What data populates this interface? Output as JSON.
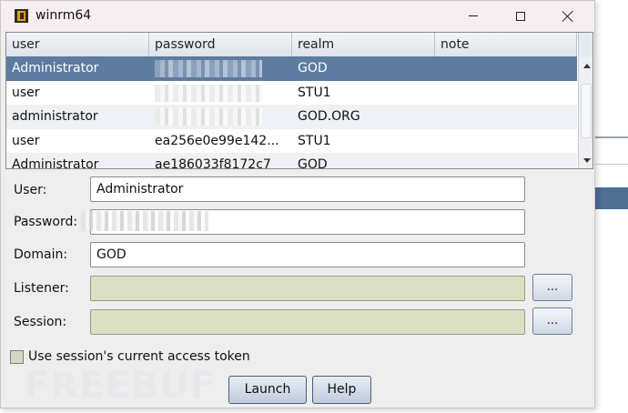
{
  "window": {
    "title": "winrm64",
    "controls": [
      "minimize-icon",
      "maximize-icon",
      "close-icon"
    ]
  },
  "table": {
    "columns": [
      "user",
      "password",
      "realm",
      "note"
    ],
    "rows": [
      {
        "user": "Administrator",
        "password": "",
        "realm": "GOD",
        "note": "",
        "selected": true
      },
      {
        "user": "user",
        "password": "",
        "realm": "STU1",
        "note": ""
      },
      {
        "user": "administrator",
        "password": "",
        "realm": "GOD.ORG",
        "note": ""
      },
      {
        "user": "user",
        "password": "ea256e0e99e142...",
        "realm": "STU1",
        "note": ""
      },
      {
        "user": "Administrator",
        "password": "ae186033f8172c7",
        "realm": "GOD",
        "note": ""
      }
    ]
  },
  "form": {
    "user_label": "User:",
    "user_value": "Administrator",
    "password_label": "Password:",
    "password_value": "",
    "domain_label": "Domain:",
    "domain_value": "GOD",
    "listener_label": "Listener:",
    "listener_value": "",
    "listener_button": "...",
    "session_label": "Session:",
    "session_value": "",
    "session_button": "...",
    "token_checkbox_label": "Use session's current access token",
    "token_checked": false
  },
  "buttons": {
    "launch": "Launch",
    "help": "Help"
  },
  "watermark": "FREEBUF",
  "colors": {
    "selected_row": "#5e7ba0",
    "disabled_field": "#dcdfc4",
    "title_bg": "#f7efef"
  }
}
